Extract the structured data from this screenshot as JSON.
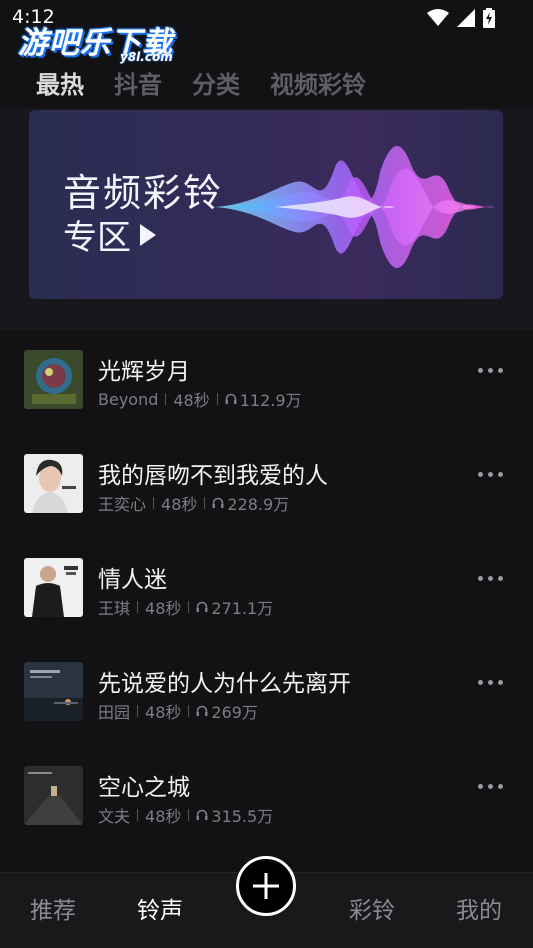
{
  "status_bar": {
    "time": "4:12"
  },
  "watermark": {
    "text": "游吧乐下载",
    "sub": "y8l.com"
  },
  "top_tabs": [
    {
      "label": "最热",
      "active": true
    },
    {
      "label": "抖音",
      "active": false
    },
    {
      "label": "分类",
      "active": false
    },
    {
      "label": "视频彩铃",
      "active": false
    }
  ],
  "banner": {
    "title": "音频彩铃",
    "subtitle": "专区"
  },
  "songs": [
    {
      "title": "光辉岁月",
      "artist": "Beyond",
      "duration": "48秒",
      "plays": "112.9万"
    },
    {
      "title": "我的唇吻不到我爱的人",
      "artist": "王奕心",
      "duration": "48秒",
      "plays": "228.9万"
    },
    {
      "title": "情人迷",
      "artist": "王琪",
      "duration": "48秒",
      "plays": "271.1万"
    },
    {
      "title": "先说爱的人为什么先离开",
      "artist": "田园",
      "duration": "48秒",
      "plays": "269万"
    },
    {
      "title": "空心之城",
      "artist": "文夫",
      "duration": "48秒",
      "plays": "315.5万"
    }
  ],
  "bottom_nav": [
    {
      "label": "推荐",
      "active": false
    },
    {
      "label": "铃声",
      "active": true
    },
    {
      "label": "彩铃",
      "active": false
    },
    {
      "label": "我的",
      "active": false
    }
  ],
  "icons": {
    "wifi": "wifi-icon",
    "signal": "signal-icon",
    "battery": "battery-charging-icon",
    "play": "play-triangle-icon",
    "headphone": "headphone-icon",
    "more": "more-dots-icon",
    "add": "plus-icon"
  }
}
